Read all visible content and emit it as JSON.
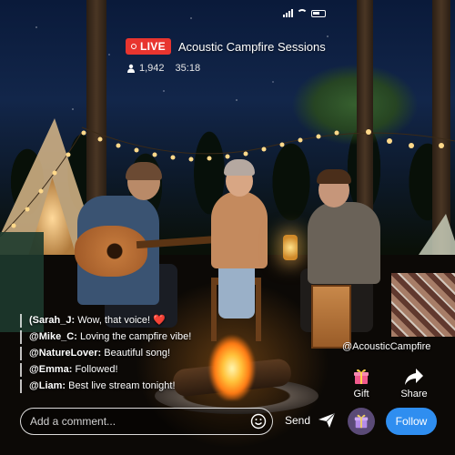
{
  "status_bar": {
    "icons": [
      "signal-icon",
      "wifi-icon",
      "battery-icon"
    ]
  },
  "stream": {
    "live_label": "LIVE",
    "title": "Acoustic Campfire Sessions",
    "viewer_count": "1,942",
    "duration": "35:18",
    "live_color": "#e8352f"
  },
  "chat": {
    "messages": [
      {
        "user": "(Sarah_J:",
        "text": " Wow, that voice! ",
        "emoji": "❤️"
      },
      {
        "user": "@Mike_C:",
        "text": " Loving the campfire vibe!"
      },
      {
        "user": "@NatureLover:",
        "text": " Beautiful song!"
      },
      {
        "user": "@Emma:",
        "text": " Followed!"
      },
      {
        "user": "@Liam:",
        "text": " Best live stream tonight!"
      }
    ]
  },
  "channel": {
    "handle": "@AcousticCampfire"
  },
  "actions": {
    "gift_label": "Gift",
    "share_label": "Share"
  },
  "bottom_bar": {
    "comment_placeholder": "Add a comment...",
    "send_label": "Send",
    "follow_label": "Follow",
    "follow_color": "#2f8ef0"
  }
}
